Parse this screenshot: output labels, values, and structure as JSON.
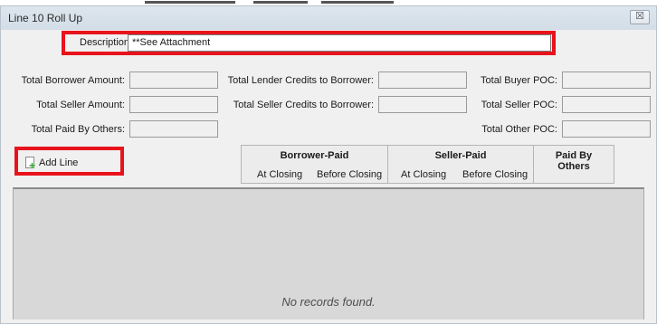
{
  "window": {
    "title": "Line 10 Roll Up",
    "close_glyph": "☒"
  },
  "description": {
    "label": "Description:",
    "value": "**See Attachment"
  },
  "fields": {
    "total_borrower_amount": "Total Borrower Amount:",
    "total_seller_amount": "Total Seller Amount:",
    "total_paid_by_others": "Total Paid By Others:",
    "total_lender_credits": "Total Lender Credits to Borrower:",
    "total_seller_credits": "Total Seller Credits to Borrower:",
    "total_buyer_poc": "Total Buyer POC:",
    "total_seller_poc": "Total Seller POC:",
    "total_other_poc": "Total Other POC:"
  },
  "toolbar": {
    "add_line_label": "Add Line",
    "add_icon": "add-page-icon"
  },
  "grid": {
    "borrower_paid": {
      "title": "Borrower-Paid",
      "at_closing": "At Closing",
      "before_closing": "Before Closing"
    },
    "seller_paid": {
      "title": "Seller-Paid",
      "at_closing": "At Closing",
      "before_closing": "Before Closing"
    },
    "paid_by_others": {
      "title_line1": "Paid By",
      "title_line2": "Others"
    },
    "empty_message": "No records found."
  },
  "colors": {
    "highlight": "#e8131b",
    "add_icon_green": "#2ca52c"
  }
}
